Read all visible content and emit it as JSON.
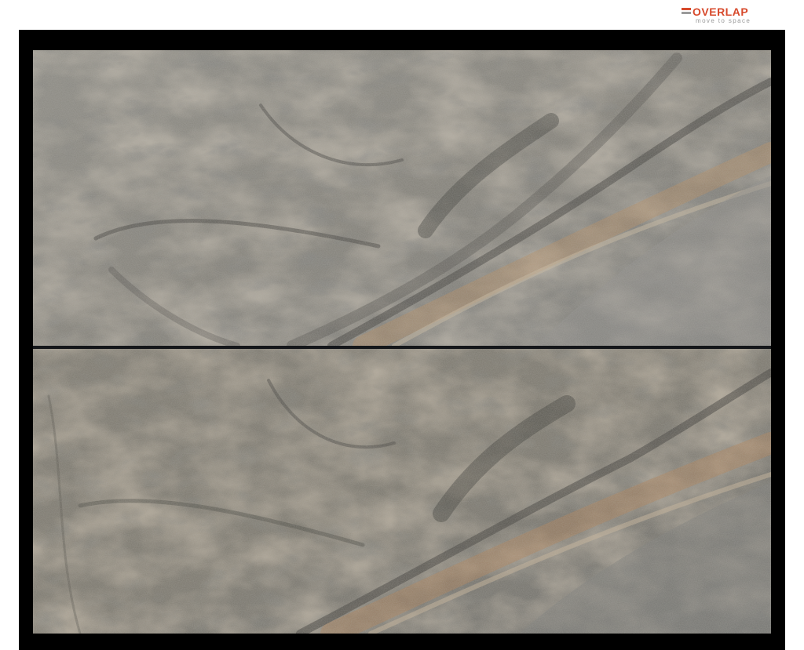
{
  "brand": {
    "name": "OVERLAP",
    "tagline": "move to space",
    "accent_color": "#d7492b",
    "secondary_color": "#9a9a9a"
  },
  "image": {
    "frame_color": "#000000",
    "slab_count": 2,
    "stone_palette": [
      "#8b8a84",
      "#a39a88",
      "#6e6c66",
      "#b8916a",
      "#4a4a47",
      "#c9b9a0"
    ]
  }
}
